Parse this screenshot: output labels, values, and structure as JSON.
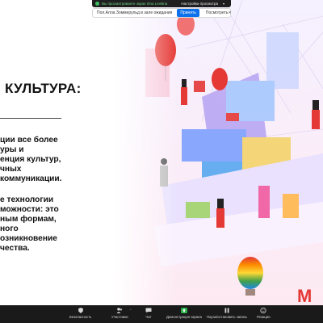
{
  "share_banner": {
    "viewing_text": "Вы просматриваете экран Irina Levitina",
    "options_label": "Настройки просмотра",
    "caret": "▾"
  },
  "waiting_room": {
    "message": "Пол.Алла Зоммерульд в зале ожидания",
    "admit_label": "Принять",
    "view_label": "Посмотреть",
    "close_label": "✕"
  },
  "slide": {
    "title": "КУЛЬТУРА:",
    "paragraph1": [
      "ции все более",
      "уры и",
      "енция культур,",
      "чных",
      "коммуникации."
    ],
    "paragraph2": [
      "е технологии",
      "можности: это",
      "ным формам,",
      "ного",
      "озникновение",
      "чества."
    ]
  },
  "toolbar": {
    "security": "Безопасность",
    "participants": "Участники",
    "participants_count": "65",
    "chat": "Чат",
    "share_screen": "Демонстрация экрана",
    "pause_recording": "Пауза/остановить запись",
    "reactions": "Реакции",
    "caret": "^"
  },
  "colors": {
    "share_green": "#3ebd5f",
    "admit_blue": "#0e71eb",
    "toolbar_bg": "#1a1a1a",
    "metro_red": "#e53935"
  }
}
